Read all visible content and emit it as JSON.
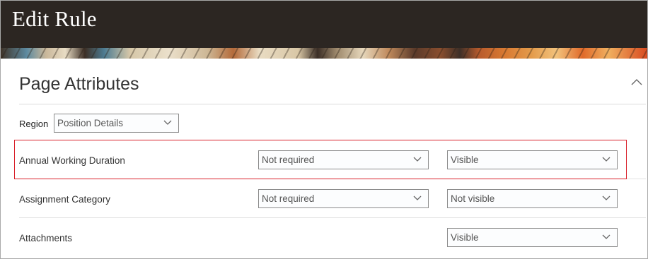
{
  "header": {
    "title": "Edit Rule"
  },
  "section": {
    "title": "Page Attributes"
  },
  "region": {
    "label": "Region",
    "value": "Position Details"
  },
  "rows": [
    {
      "label": "Annual Working Duration",
      "required": "Not required",
      "visibility": "Visible"
    },
    {
      "label": "Assignment Category",
      "required": "Not required",
      "visibility": "Not visible"
    },
    {
      "label": "Attachments",
      "visibility": "Visible"
    }
  ],
  "icons": {
    "collapse": "chevron-up-icon",
    "dropdown": "chevron-down-icon"
  },
  "colors": {
    "header_bg": "#2c2622",
    "highlight": "#d9202a"
  }
}
